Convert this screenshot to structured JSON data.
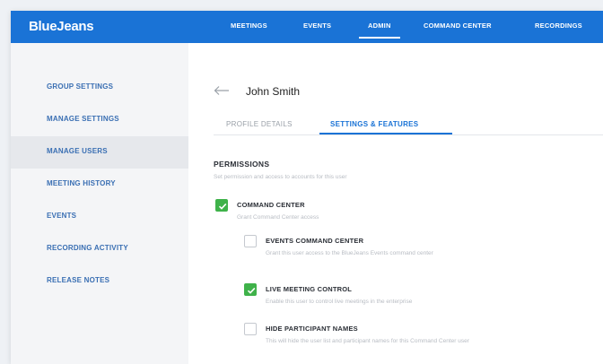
{
  "app": {
    "logo": "BlueJeans"
  },
  "nav": {
    "items": [
      "MEETINGS",
      "EVENTS",
      "ADMIN",
      "COMMAND CENTER",
      "RECORDINGS"
    ],
    "active": "ADMIN"
  },
  "sidebar": {
    "items": [
      {
        "label": "GROUP SETTINGS"
      },
      {
        "label": "MANAGE SETTINGS"
      },
      {
        "label": "MANAGE USERS"
      },
      {
        "label": "MEETING HISTORY"
      },
      {
        "label": "EVENTS"
      },
      {
        "label": "RECORDING ACTIVITY"
      },
      {
        "label": "RELEASE NOTES"
      }
    ],
    "active": "MANAGE USERS"
  },
  "user": {
    "name": "John Smith"
  },
  "tabs": {
    "profile": "PROFILE DETAILS",
    "settings": "SETTINGS & FEATURES"
  },
  "permissions": {
    "title": "PERMISSIONS",
    "description": "Set permission and access to accounts for this user",
    "items": [
      {
        "label": "COMMAND CENTER",
        "description": "Grant Command Center access",
        "checked": true
      },
      {
        "label": "EVENTS COMMAND CENTER",
        "description": "Grant this user access to the BlueJeans Events command center",
        "checked": false
      },
      {
        "label": "LIVE MEETING CONTROL",
        "description": "Enable this user to control live meetings in the enterprise",
        "checked": true
      },
      {
        "label": "HIDE PARTICIPANT NAMES",
        "description": "This will hide the user list and participant names for this Command Center user",
        "checked": false
      }
    ]
  },
  "colors": {
    "brand": "#1a73d6",
    "check": "#3fb24a",
    "sidebar_link": "#3a6fb3"
  }
}
